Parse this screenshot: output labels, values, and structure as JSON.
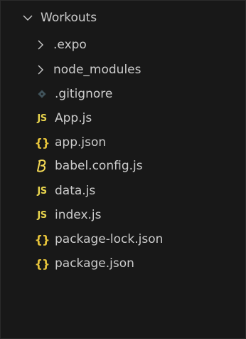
{
  "explorer": {
    "root": {
      "label": "Workouts",
      "expanded": true
    },
    "folders": [
      {
        "label": ".expo"
      },
      {
        "label": "node_modules"
      }
    ],
    "files": [
      {
        "label": ".gitignore",
        "icon": "git-icon"
      },
      {
        "label": "App.js",
        "icon": "javascript-icon"
      },
      {
        "label": "app.json",
        "icon": "json-icon"
      },
      {
        "label": "babel.config.js",
        "icon": "babel-icon"
      },
      {
        "label": "data.js",
        "icon": "javascript-icon"
      },
      {
        "label": "index.js",
        "icon": "javascript-icon"
      },
      {
        "label": "package-lock.json",
        "icon": "json-icon"
      },
      {
        "label": "package.json",
        "icon": "json-icon"
      }
    ],
    "icon_glyphs": {
      "js": "JS",
      "json": "{}"
    }
  },
  "colors": {
    "background": "#181818",
    "text": "#cccccc",
    "js_icon": "#e8d44d",
    "json_icon": "#e8c53b",
    "git_icon": "#41535b",
    "babel_icon": "#f5da55"
  }
}
